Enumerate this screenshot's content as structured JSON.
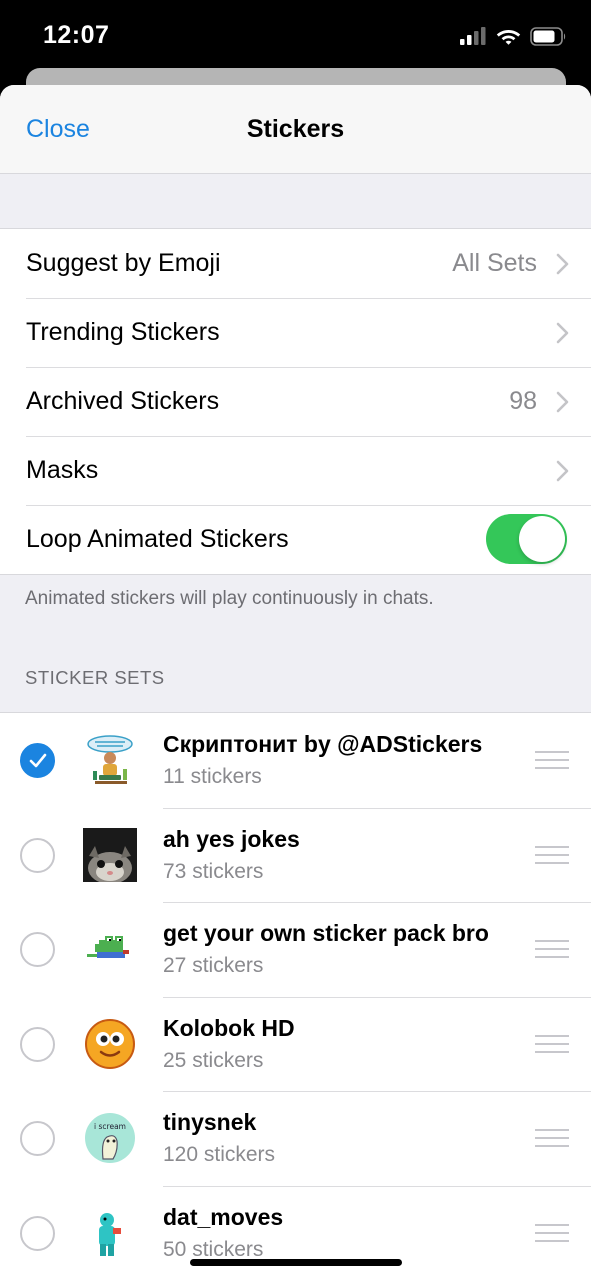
{
  "status_bar": {
    "time": "12:07"
  },
  "nav": {
    "close_label": "Close",
    "title": "Stickers"
  },
  "settings": [
    {
      "label": "Suggest by Emoji",
      "value": "All Sets",
      "chevron": true
    },
    {
      "label": "Trending Stickers",
      "value": "",
      "chevron": true
    },
    {
      "label": "Archived Stickers",
      "value": "98",
      "chevron": true
    },
    {
      "label": "Masks",
      "value": "",
      "chevron": true
    },
    {
      "label": "Loop Animated Stickers",
      "toggle_on": true
    }
  ],
  "loop_footer": "Animated stickers will play continuously in chats.",
  "section_header": "STICKER SETS",
  "sticker_sets": [
    {
      "title": "Скриптонит by @ADStickers",
      "count": "11 stickers",
      "selected": true,
      "thumb_icon": "scriptonite-sticker-icon"
    },
    {
      "title": "ah yes jokes",
      "count": "73 stickers",
      "selected": false,
      "thumb_icon": "cat-photo-sticker-icon"
    },
    {
      "title": "get your own sticker pack bro",
      "count": "27 stickers",
      "selected": false,
      "thumb_icon": "pixel-frog-sticker-icon"
    },
    {
      "title": "Kolobok HD",
      "count": "25 stickers",
      "selected": false,
      "thumb_icon": "kolobok-face-sticker-icon"
    },
    {
      "title": "tinysnek",
      "count": "120 stickers",
      "selected": false,
      "thumb_icon": "snek-sticker-icon",
      "thumb_text": "i scream"
    },
    {
      "title": "dat_moves",
      "count": "50 stickers",
      "selected": false,
      "thumb_icon": "dancing-figure-sticker-icon"
    }
  ],
  "colors": {
    "accent": "#1b84e0",
    "toggle_on": "#34c759",
    "secondary_text": "#8a8a8e",
    "background": "#efeff4"
  }
}
